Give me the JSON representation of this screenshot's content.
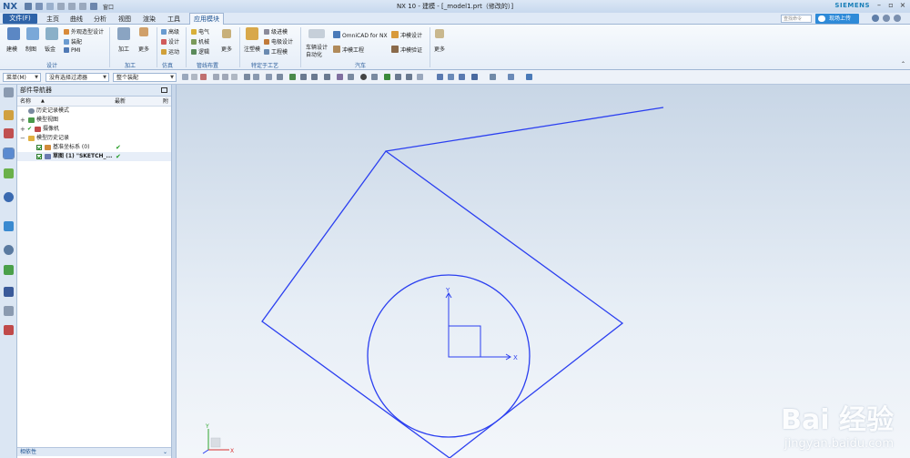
{
  "titlebar": {
    "app_logo": "NX",
    "window_menu": "窗口",
    "title": "NX 10 - 建模 - [_model1.prt（修改的）]",
    "brand": "SIEMENS"
  },
  "menubar": {
    "file": "文件(F)",
    "tabs": [
      "主页",
      "曲线",
      "分析",
      "视图",
      "渲染",
      "工具",
      "应用模块"
    ],
    "command_search_placeholder": "查找命令",
    "cloud_button": "现场上传"
  },
  "ribbon": {
    "design": {
      "big": [
        "建模",
        "制图",
        "钣金"
      ],
      "small": [
        "外观造型设计",
        "装配",
        "PMI"
      ],
      "label": "设计"
    },
    "machining": {
      "big": [
        "加工",
        "更多"
      ],
      "label": "加工"
    },
    "simulation": {
      "small": [
        "高级",
        "设计",
        "运动"
      ],
      "label": "仿真"
    },
    "piping": {
      "small": [
        "电气",
        "机械",
        "逻辑"
      ],
      "more": "更多",
      "label": "管线布置"
    },
    "process": {
      "big": [
        "注塑模"
      ],
      "small": [
        "级进模",
        "电极设计",
        "工程模"
      ],
      "label": "特定于工艺"
    },
    "auto": {
      "small": [
        "车辆设计自动化",
        "OmniCAD for NX",
        "冲模工程",
        "冲模设计",
        "冲模验证"
      ],
      "label": "汽车"
    },
    "more_group": "更多"
  },
  "toolbar2": {
    "menu_dropdown": "菜单(M)",
    "filter_dropdown": "没有选择过滤器",
    "assembly_dropdown": "整个装配"
  },
  "navigator": {
    "title": "部件导航器",
    "columns": [
      "名称",
      "最新",
      "附"
    ],
    "rows": [
      {
        "label": "历史记录模式",
        "latest": ""
      },
      {
        "label": "模型视图",
        "latest": ""
      },
      {
        "label": "摄像机",
        "latest": ""
      },
      {
        "label": "模型历史记录",
        "latest": ""
      },
      {
        "label": "基准坐标系 (0)",
        "latest": "✔"
      },
      {
        "label": "草图 (1) \"SKETCH_...",
        "latest": "✔"
      }
    ],
    "dependencies": "相依性"
  },
  "viewport": {
    "axis_x": "X",
    "axis_y": "Y",
    "triad_x": "X",
    "triad_y": "Y"
  },
  "watermark": {
    "logo": "Bai 经验",
    "url": "jingyan.baidu.com"
  },
  "colors": {
    "sketch_line": "#2b3ff0",
    "accent": "#2e63a8"
  }
}
